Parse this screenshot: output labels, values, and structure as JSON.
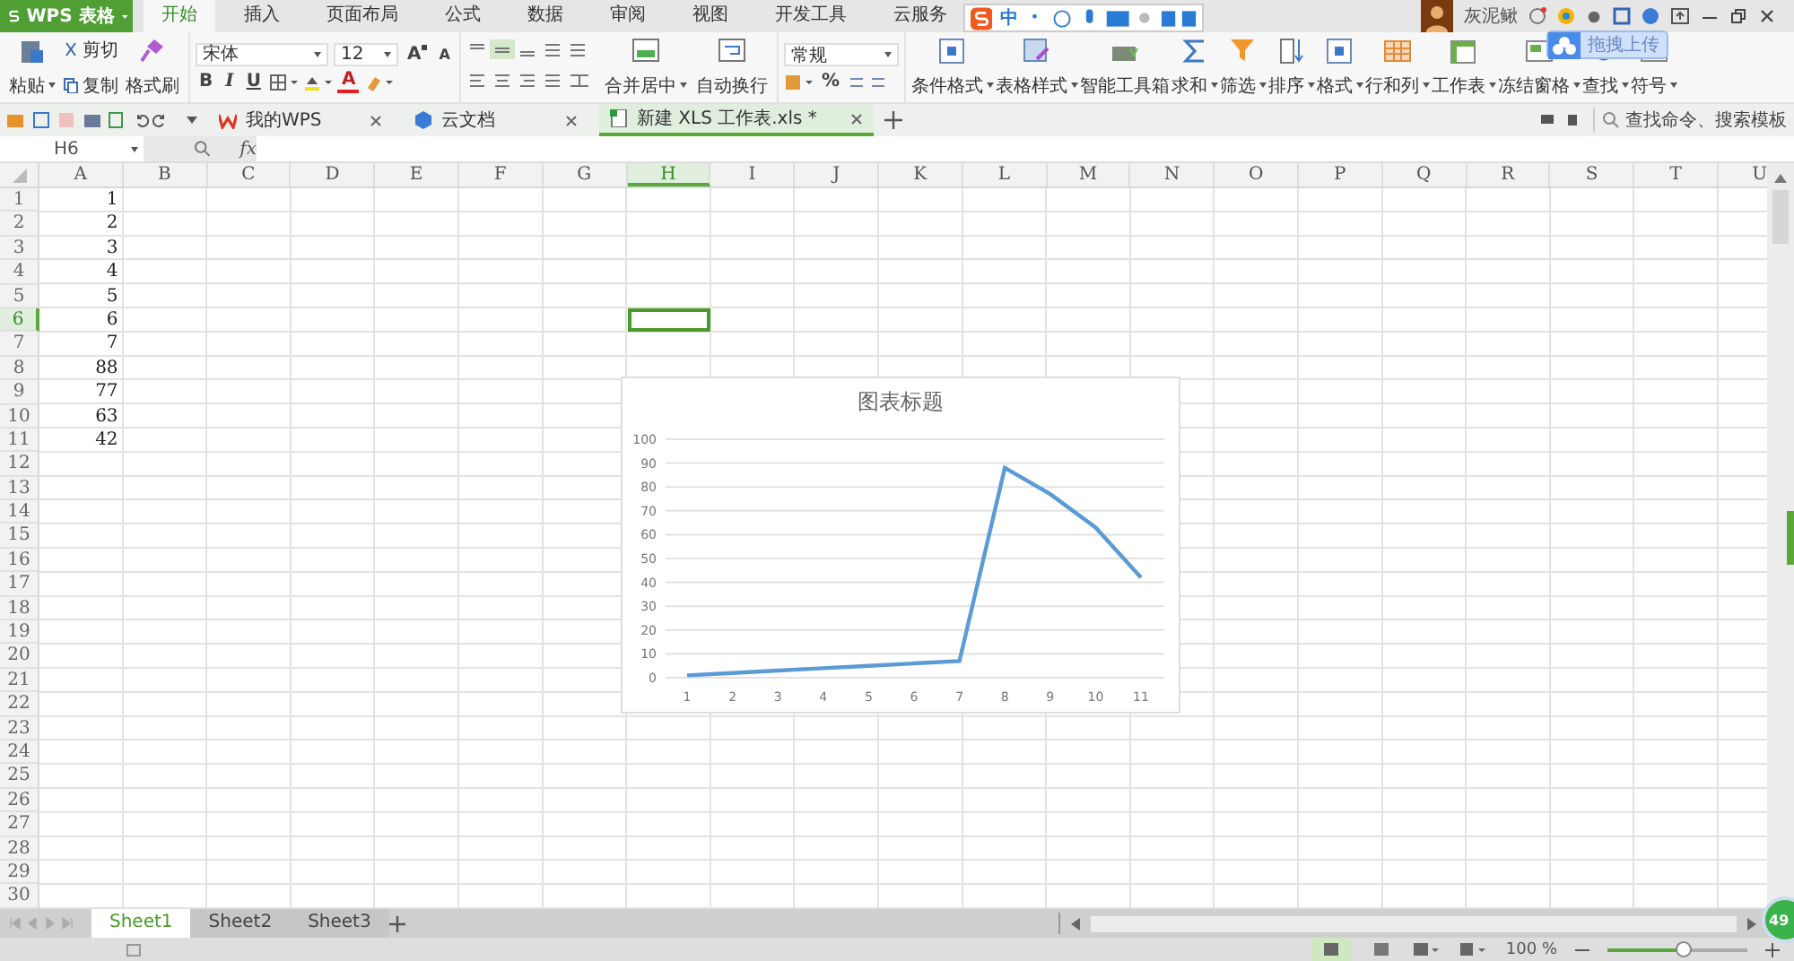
{
  "app_button": {
    "label": "WPS 表格"
  },
  "menu_tabs": [
    {
      "label": "开始",
      "selected": true
    },
    {
      "label": "插入",
      "selected": false
    },
    {
      "label": "页面布局",
      "selected": false
    },
    {
      "label": "公式",
      "selected": false
    },
    {
      "label": "数据",
      "selected": false
    },
    {
      "label": "审阅",
      "selected": false
    },
    {
      "label": "视图",
      "selected": false
    },
    {
      "label": "开发工具",
      "selected": false
    },
    {
      "label": "云服务",
      "selected": false
    }
  ],
  "ime_bar": {
    "label": "中"
  },
  "user": {
    "name": "灰泥鳅"
  },
  "upload_popup": {
    "label": "拖拽上传"
  },
  "clipboard": {
    "paste": "粘贴",
    "cut": "剪切",
    "copy": "复制",
    "format_painter": "格式刷"
  },
  "font": {
    "name": "宋体",
    "size": "12",
    "size_buttons": [
      "A",
      "A"
    ],
    "style_buttons": [
      "B",
      "I",
      "U"
    ],
    "font_color": "A"
  },
  "align_buttons": [
    {
      "label": "合并居中",
      "kind": "merge",
      "dropdown": true
    },
    {
      "label": "自动换行",
      "kind": "wrap",
      "dropdown": false
    }
  ],
  "number_format": {
    "value": "常规",
    "percent": "%"
  },
  "tool_buttons": [
    {
      "label": "条件格式",
      "kind": "grid",
      "dropdown": true
    },
    {
      "label": "表格样式",
      "kind": "style",
      "dropdown": true
    },
    {
      "label": "智能工具箱",
      "kind": "toolbox",
      "dropdown": false
    },
    {
      "label": "求和",
      "kind": "sigma",
      "dropdown": true
    },
    {
      "label": "筛选",
      "kind": "funnel",
      "dropdown": true
    },
    {
      "label": "排序",
      "kind": "sort",
      "dropdown": true
    },
    {
      "label": "格式",
      "kind": "grid",
      "dropdown": true
    },
    {
      "label": "行和列",
      "kind": "rows",
      "dropdown": true
    },
    {
      "label": "工作表",
      "kind": "sheet",
      "dropdown": true
    },
    {
      "label": "冻结窗格",
      "kind": "freeze",
      "dropdown": true
    },
    {
      "label": "查找",
      "kind": "search",
      "dropdown": true
    },
    {
      "label": "符号",
      "kind": "symbol",
      "dropdown": true
    }
  ],
  "doc_tabs": [
    {
      "label": "我的WPS",
      "kind": "wps",
      "selected": false
    },
    {
      "label": "云文档",
      "kind": "cloud",
      "selected": false
    },
    {
      "label": "新建 XLS 工作表.xls *",
      "kind": "sheet",
      "selected": true
    }
  ],
  "command_search": {
    "placeholder": "查找命令、搜索模板"
  },
  "name_box": {
    "value": "H6"
  },
  "formula_bar": {
    "fx_label": "fx"
  },
  "columns": [
    {
      "label": "A",
      "selected": false
    },
    {
      "label": "B",
      "selected": false
    },
    {
      "label": "C",
      "selected": false
    },
    {
      "label": "D",
      "selected": false
    },
    {
      "label": "E",
      "selected": false
    },
    {
      "label": "F",
      "selected": false
    },
    {
      "label": "G",
      "selected": false
    },
    {
      "label": "H",
      "selected": true
    },
    {
      "label": "I",
      "selected": false
    },
    {
      "label": "J",
      "selected": false
    },
    {
      "label": "K",
      "selected": false
    },
    {
      "label": "L",
      "selected": false
    },
    {
      "label": "M",
      "selected": false
    },
    {
      "label": "N",
      "selected": false
    },
    {
      "label": "O",
      "selected": false
    },
    {
      "label": "P",
      "selected": false
    },
    {
      "label": "Q",
      "selected": false
    },
    {
      "label": "R",
      "selected": false
    },
    {
      "label": "S",
      "selected": false
    },
    {
      "label": "T",
      "selected": false
    },
    {
      "label": "U",
      "selected": false
    }
  ],
  "rows": [
    {
      "label": "1",
      "selected": false,
      "cells": [
        "1"
      ]
    },
    {
      "label": "2",
      "selected": false,
      "cells": [
        "2"
      ]
    },
    {
      "label": "3",
      "selected": false,
      "cells": [
        "3"
      ]
    },
    {
      "label": "4",
      "selected": false,
      "cells": [
        "4"
      ]
    },
    {
      "label": "5",
      "selected": false,
      "cells": [
        "5"
      ]
    },
    {
      "label": "6",
      "selected": true,
      "cells": [
        "6"
      ]
    },
    {
      "label": "7",
      "selected": false,
      "cells": [
        "7"
      ]
    },
    {
      "label": "8",
      "selected": false,
      "cells": [
        "88"
      ]
    },
    {
      "label": "9",
      "selected": false,
      "cells": [
        "77"
      ]
    },
    {
      "label": "10",
      "selected": false,
      "cells": [
        "63"
      ]
    },
    {
      "label": "11",
      "selected": false,
      "cells": [
        "42"
      ]
    },
    {
      "label": "12",
      "selected": false
    },
    {
      "label": "13",
      "selected": false
    },
    {
      "label": "14",
      "selected": false
    },
    {
      "label": "15",
      "selected": false
    },
    {
      "label": "16",
      "selected": false
    },
    {
      "label": "17",
      "selected": false
    },
    {
      "label": "18",
      "selected": false
    },
    {
      "label": "19",
      "selected": false
    },
    {
      "label": "20",
      "selected": false
    },
    {
      "label": "21",
      "selected": false
    },
    {
      "label": "22",
      "selected": false
    },
    {
      "label": "23",
      "selected": false
    },
    {
      "label": "24",
      "selected": false
    },
    {
      "label": "25",
      "selected": false
    },
    {
      "label": "26",
      "selected": false
    },
    {
      "label": "27",
      "selected": false
    },
    {
      "label": "28",
      "selected": false
    },
    {
      "label": "29",
      "selected": false
    },
    {
      "label": "30",
      "selected": false
    }
  ],
  "chart": {
    "chart_data": {
      "type": "line",
      "title": "图表标题",
      "categories": [
        "1",
        "2",
        "3",
        "4",
        "5",
        "6",
        "7",
        "8",
        "9",
        "10",
        "11"
      ],
      "series": [
        {
          "color": "#5b9bd5",
          "values": [
            1,
            2,
            3,
            4,
            5,
            6,
            7,
            88,
            77,
            63,
            42
          ]
        }
      ],
      "ylim": [
        0,
        100
      ],
      "yticks": [
        0,
        10,
        20,
        30,
        40,
        50,
        60,
        70,
        80,
        90,
        100
      ],
      "grid": true
    }
  },
  "sheet_tabs": [
    {
      "label": "Sheet1",
      "selected": true
    },
    {
      "label": "Sheet2",
      "selected": false
    },
    {
      "label": "Sheet3",
      "selected": false
    }
  ],
  "status_bar": {
    "zoom": "100 %",
    "zoom_slider": {
      "level": 0.55
    }
  },
  "floating_ball": {
    "label": "49"
  }
}
